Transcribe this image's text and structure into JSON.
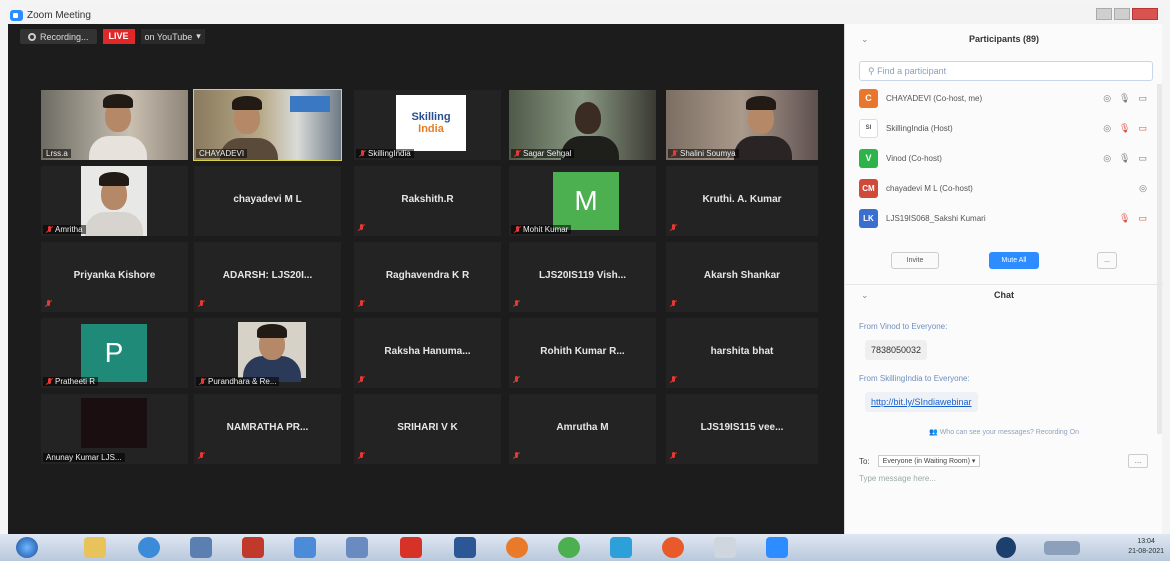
{
  "window": {
    "title": "Zoom Meeting"
  },
  "topbar": {
    "recording_label": "Recording...",
    "live_label": "LIVE",
    "youtube_label": "on YouTube"
  },
  "tiles": [
    {
      "label": "Lrss.a"
    },
    {
      "label": "CHAYADEVI"
    },
    {
      "label": "SkillingIndia",
      "logo_line1": "Skilling",
      "logo_line2": "India"
    },
    {
      "label": "Sagar Sehgal"
    },
    {
      "label": "Shalini Soumya"
    },
    {
      "label": "Amritha"
    },
    {
      "name": "chayadevi M L"
    },
    {
      "name": "Rakshith.R"
    },
    {
      "label": "Mohit Kumar",
      "initial": "M"
    },
    {
      "name": "Kruthi. A. Kumar"
    },
    {
      "name": "Priyanka Kishore"
    },
    {
      "name": "ADARSH: LJS20I..."
    },
    {
      "name": "Raghavendra K R"
    },
    {
      "name": "LJS20IS119 Vish..."
    },
    {
      "name": "Akarsh Shankar"
    },
    {
      "label": "Pratheeti R",
      "initial": "P"
    },
    {
      "label": "Purandhara & Re..."
    },
    {
      "name": "Raksha Hanuma..."
    },
    {
      "name": "Rohith Kumar R..."
    },
    {
      "name": "harshita bhat"
    },
    {
      "label": "Anunay Kumar LJS..."
    },
    {
      "name": "NAMRATHA PR..."
    },
    {
      "name": "SRIHARI V K"
    },
    {
      "name": "Amrutha M"
    },
    {
      "name": "LJS19IS115 vee..."
    }
  ],
  "participants": {
    "title": "Participants (89)",
    "search_placeholder": "Find a participant",
    "items": [
      {
        "initial": "C",
        "name": "CHAYADEVI (Co-host, me)",
        "color": "#e8762c"
      },
      {
        "initial": "SI",
        "name": "SkillingIndia (Host)",
        "color": "#ffffff"
      },
      {
        "initial": "V",
        "name": "Vinod (Co-host)",
        "color": "#2db34a"
      },
      {
        "initial": "CM",
        "name": "chayadevi M L (Co-host)",
        "color": "#d04a3a"
      },
      {
        "initial": "LK",
        "name": "LJS19IS068_Sakshi Kumari",
        "color": "#3a6fd0"
      }
    ],
    "invite_label": "Invite",
    "mute_all_label": "Mute All",
    "more_label": "..."
  },
  "chat": {
    "title": "Chat",
    "messages": [
      {
        "meta": "From Vinod to Everyone:",
        "body": "7838050032"
      },
      {
        "meta": "From SkillingIndia to Everyone:",
        "body": "http://bit.ly/SIndiawebinar"
      }
    ],
    "notice": "Who can see your messages? Recording On",
    "to_label": "To:",
    "to_value": "Everyone (in Waiting Room) ▾",
    "compose_placeholder": "Type message here...",
    "more_label": "..."
  },
  "tray": {
    "time": "13:04",
    "date": "21-08-2021"
  }
}
